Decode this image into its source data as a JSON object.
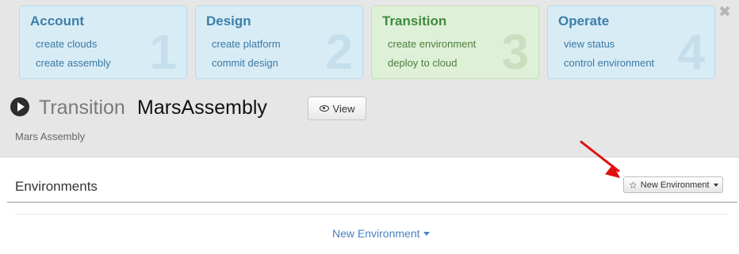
{
  "steps": [
    {
      "title": "Account",
      "links": [
        "create clouds",
        "create assembly"
      ],
      "number": "1",
      "active": false
    },
    {
      "title": "Design",
      "links": [
        "create platform",
        "commit design"
      ],
      "number": "2",
      "active": false
    },
    {
      "title": "Transition",
      "links": [
        "create environment",
        "deploy to cloud"
      ],
      "number": "3",
      "active": true
    },
    {
      "title": "Operate",
      "links": [
        "view status",
        "control environment"
      ],
      "number": "4",
      "active": false
    }
  ],
  "header": {
    "close_glyph": "✖",
    "play_icon": "play-circle-icon",
    "title_prefix": "Transition",
    "title_name": "MarsAssembly",
    "view_button": "View",
    "view_icon": "eye-icon",
    "subtitle": "Mars Assembly"
  },
  "environments": {
    "section_title": "Environments",
    "new_button_label": "New Environment",
    "new_button_icon": "star-icon",
    "star_glyph": "☆",
    "link_label": "New Environment"
  },
  "annotation": {
    "arrow_color": "#e01010"
  },
  "colors": {
    "step_blue": "#d8ecf6",
    "step_green": "#dff0d8",
    "link_blue": "#4a82c0"
  }
}
